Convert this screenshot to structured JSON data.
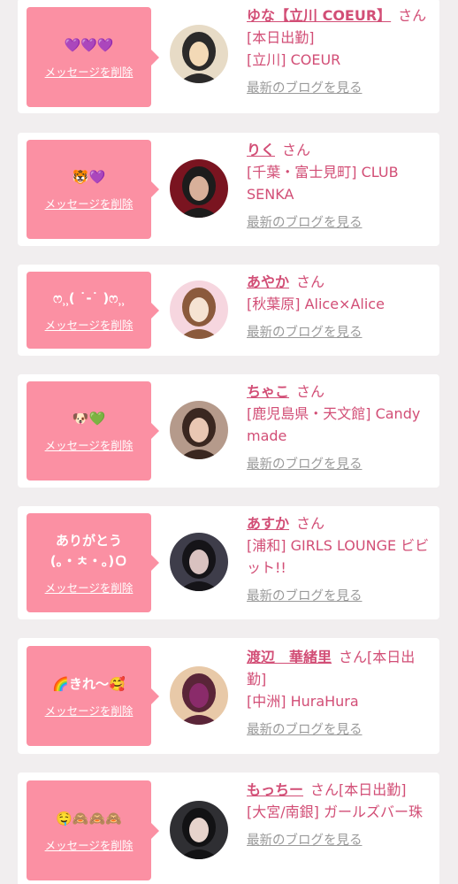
{
  "favorites": [
    {
      "message": "💜💜💜",
      "delete_label": "メッセージを削除",
      "name": "ゆな【立川 COEUR】",
      "honorific": "さん",
      "status": "[本日出勤]",
      "shop": "[立川] COEUR",
      "blog_label": "最新のブログを見る",
      "avatar_colors": [
        "#e7dbc6",
        "#2b2a2a",
        "#f3d9b6"
      ]
    },
    {
      "message": "🐯💜",
      "delete_label": "メッセージを削除",
      "name": "りく",
      "honorific": "さん",
      "status": "",
      "shop": "[千葉・富士見町] CLUB SENKA",
      "blog_label": "最新のブログを見る",
      "avatar_colors": [
        "#7a1420",
        "#1c1c1c",
        "#d8b09a"
      ]
    },
    {
      "message": "ෆ⸒⸒( ˙-˙ )ෆ⸒⸒",
      "delete_label": "メッセージを削除",
      "name": "あやか",
      "honorific": "さん",
      "status": "",
      "shop": "[秋葉原] Alice×Alice",
      "blog_label": "最新のブログを見る",
      "avatar_colors": [
        "#f6d6df",
        "#8b5a3c",
        "#f5e3d3"
      ]
    },
    {
      "message": "🐶💚",
      "delete_label": "メッセージを削除",
      "name": "ちゃこ",
      "honorific": "さん",
      "status": "",
      "shop": "[鹿児島県・天文館] Candy made",
      "blog_label": "最新のブログを見る",
      "avatar_colors": [
        "#b59a8b",
        "#3a2720",
        "#e9c7b3"
      ]
    },
    {
      "message": "ありがとう\n(｡・ㅊ・｡)Ｏ",
      "delete_label": "メッセージを削除",
      "name": "あすか",
      "honorific": "さん",
      "status": "",
      "shop": "[浦和] GIRLS LOUNGE ビビット!!",
      "blog_label": "最新のブログを見る",
      "avatar_colors": [
        "#3e3d4a",
        "#151418",
        "#d9c2c0"
      ]
    },
    {
      "message": "🌈きれ〜🥰",
      "delete_label": "メッセージを削除",
      "name": "渡辺　華緒里",
      "honorific": "さん",
      "status": "[本日出勤]",
      "shop": "[中洲] HuraHura",
      "blog_label": "最新のブログを見る",
      "avatar_colors": [
        "#e8c9a8",
        "#5a2538",
        "#8a2b6a"
      ]
    },
    {
      "message": "🤤🙈🙈🙈",
      "delete_label": "メッセージを削除",
      "name": "もっちー",
      "honorific": "さん",
      "status": "[本日出勤]",
      "shop": "[大宮/南銀] ガールズバー珠",
      "blog_label": "最新のブログを見る",
      "avatar_colors": [
        "#2f2f33",
        "#121214",
        "#e6d3cc"
      ]
    }
  ]
}
